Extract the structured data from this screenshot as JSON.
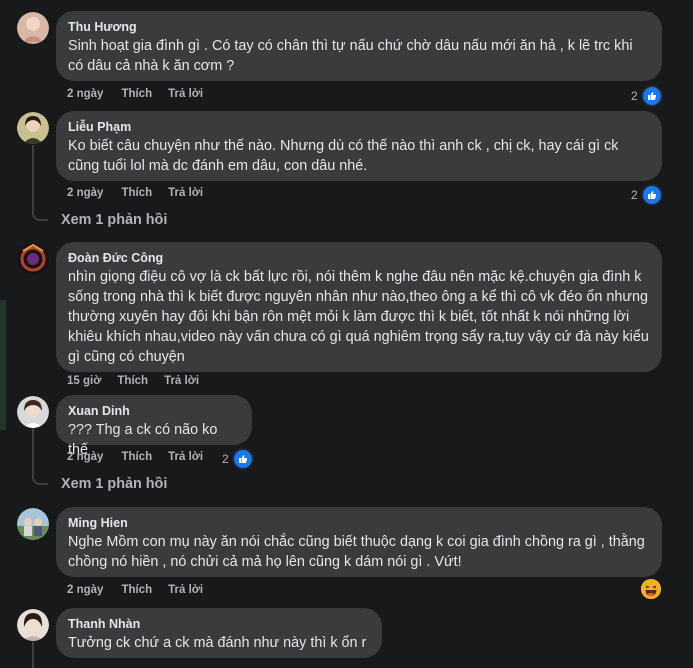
{
  "comments": [
    {
      "author": "Thu Hương",
      "text": "Sinh hoạt gia đình gì . Có tay có chân thì tự nấu chứ chờ dâu nấu mới ăn hả , k lẽ trc khi có dâu cả nhà k ăn cơm ?",
      "time": "2 ngày",
      "like_label": "Thích",
      "reply_label": "Trả lời",
      "reaction_count": "2",
      "reaction_icon": "like-icon"
    },
    {
      "author": "Liễu Phạm",
      "text": "Ko biết câu chuyện như thế nào. Nhưng dù có thế nào thì anh ck , chị ck, hay cái gì ck cũng tuổi lol mà dc đánh em dâu, con dâu nhé.",
      "time": "2 ngày",
      "like_label": "Thích",
      "reply_label": "Trả lời",
      "reaction_count": "2",
      "reaction_icon": "like-icon",
      "view_replies": "Xem 1 phản hồi"
    },
    {
      "author": "Đoàn Đức Công",
      "text": "nhìn giọng điệu cô vợ là ck bất lực rồi, nói thêm k nghe đâu nên mặc kệ.chuyện gia đình k sống trong nhà thì k biết được nguyên nhân như nào,theo ông a kể thì cô vk đéo ổn nhưng thường xuyên hay đôi khi bận rôn mệt mỏi k làm được thì k biết, tốt nhất k nói những lời khiêu khích nhau,video này vấn chưa có gì quá nghiêm trọng sẩy ra,tuy vậy cứ đà này kiểu gì cũng có chuyện",
      "time": "15 giờ",
      "like_label": "Thích",
      "reply_label": "Trả lời"
    },
    {
      "author": "Xuan Dinh",
      "text": "??? Thg a ck có não ko thế",
      "time": "2 ngày",
      "like_label": "Thích",
      "reply_label": "Trả lời",
      "reaction_count": "2",
      "reaction_icon": "like-icon",
      "view_replies": "Xem 1 phản hồi"
    },
    {
      "author": "Ming Hien",
      "text": "Nghe Mồm con mụ này ăn nói chắc cũng biết thuộc dạng k coi gia đình chồng ra gì , thằng chồng nó hiền , nó chửi cả mả họ lên cũng k dám nói gì . Vứt!",
      "time": "2 ngày",
      "like_label": "Thích",
      "reply_label": "Trả lời",
      "reaction_icon": "haha-icon"
    },
    {
      "author": "Thanh Nhàn",
      "text": "Tưởng ck chứ a ck mà đánh như này thì k ổn r"
    }
  ],
  "colors": {
    "background": "#18191a",
    "bubble": "#3a3b3c",
    "text": "#e4e6eb",
    "secondary": "#b0b3b8",
    "like_blue": "#1877f2",
    "haha_yellow": "#f7b125"
  }
}
